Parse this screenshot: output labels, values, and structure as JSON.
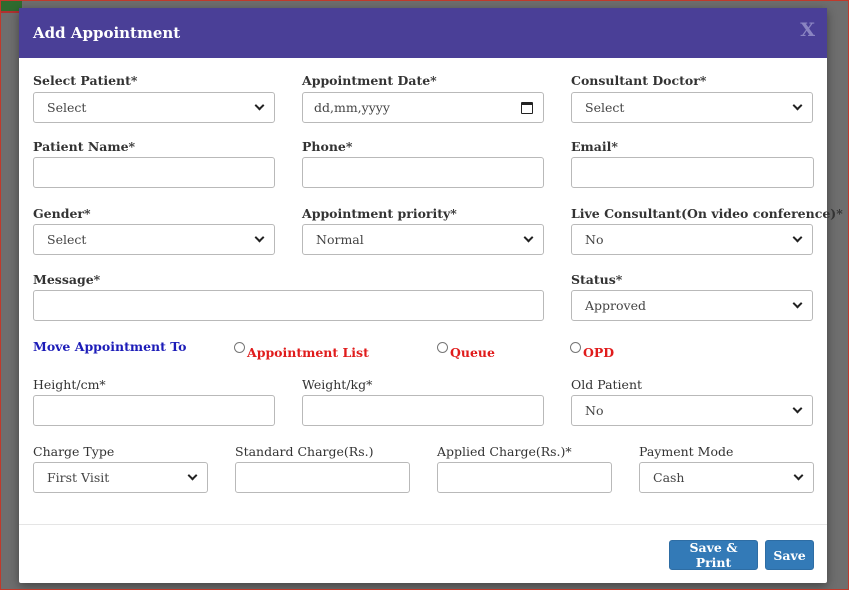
{
  "dialog": {
    "title": "Add Appointment",
    "close_glyph": "X"
  },
  "fields": {
    "select_patient": {
      "label": "Select Patient*",
      "value": "Select"
    },
    "appointment_date": {
      "label": "Appointment Date*",
      "placeholder": "dd,mm,yyyy"
    },
    "consultant_doctor": {
      "label": "Consultant Doctor*",
      "value": "Select"
    },
    "patient_name": {
      "label": "Patient Name*",
      "value": ""
    },
    "phone": {
      "label": "Phone*",
      "value": ""
    },
    "email": {
      "label": "Email*",
      "value": ""
    },
    "gender": {
      "label": "Gender*",
      "value": "Select"
    },
    "appointment_priority": {
      "label": "Appointment priority*",
      "value": "Normal"
    },
    "live_consultant": {
      "label": "Live Consultant(On video conference)*",
      "value": "No"
    },
    "message": {
      "label": "Message*",
      "value": ""
    },
    "status": {
      "label": "Status*",
      "value": "Approved"
    },
    "height": {
      "label": "Height/cm*",
      "value": ""
    },
    "weight": {
      "label": "Weight/kg*",
      "value": ""
    },
    "old_patient": {
      "label": "Old Patient",
      "value": "No"
    },
    "charge_type": {
      "label": "Charge Type",
      "value": "First Visit"
    },
    "standard_charge": {
      "label": "Standard Charge(Rs.)",
      "value": ""
    },
    "applied_charge": {
      "label": "Applied Charge(Rs.)*",
      "value": ""
    },
    "payment_mode": {
      "label": "Payment Mode",
      "value": "Cash"
    }
  },
  "move_to": {
    "label": "Move Appointment To",
    "options": [
      "Appointment List",
      "Queue",
      "OPD"
    ]
  },
  "footer": {
    "save_print_label": "Save & Print",
    "save_label": "Save"
  },
  "colors": {
    "header": "#4a3f97",
    "button": "#337ab7",
    "radio_label": "#e01c1c",
    "move_label": "#1c1cb8"
  }
}
